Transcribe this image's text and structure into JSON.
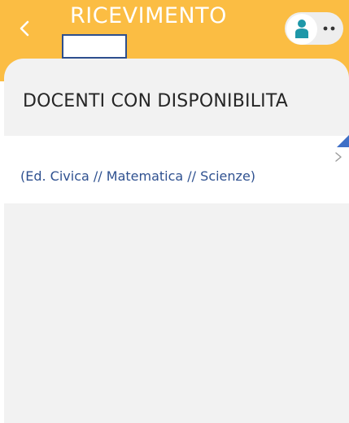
{
  "header": {
    "title": "RICEVIMENTO",
    "back_icon": "chevron-left-icon",
    "avatar_icon": "user-icon",
    "more_icon": "more-dots-icon"
  },
  "section": {
    "title": "DOCENTI CON DISPONIBILITA"
  },
  "list": {
    "items": [
      {
        "subjects": "(Ed. Civica // Matematica // Scienze)",
        "chevron_icon": "chevron-right-icon"
      }
    ]
  },
  "colors": {
    "header_bg": "#fbbd43",
    "accent_text": "#2f5190",
    "avatar_teal": "#1e97a8",
    "sheet_bg": "#f2f2f2"
  }
}
